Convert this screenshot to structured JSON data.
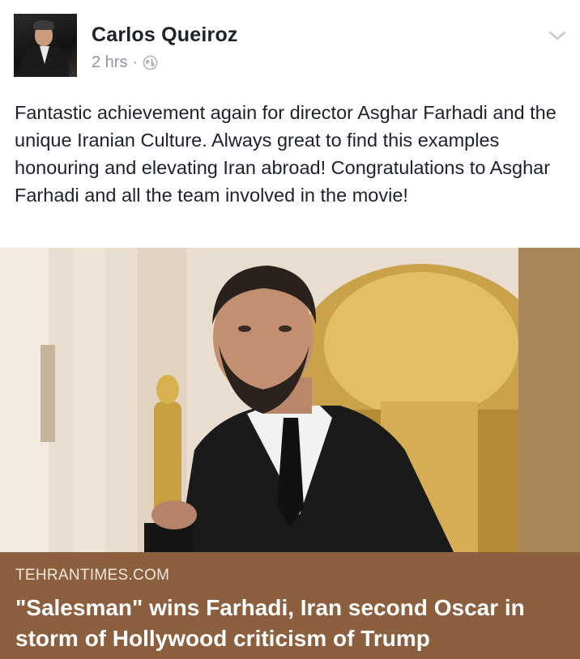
{
  "post": {
    "author": "Carlos Queiroz",
    "time": "2 hrs",
    "separator": "·",
    "privacy_icon": "globe-icon",
    "menu_icon": "chevron-down-icon",
    "text": "Fantastic achievement again for director Asghar Farhadi and the unique Iranian Culture. Always great to find this examples honouring and elevating Iran abroad! Congratulations to Asghar Farhadi and all the team involved in the movie!"
  },
  "link": {
    "domain": "TEHRANTIMES.COM",
    "title": "\"Salesman\" wins Farhadi, Iran second Oscar in storm of Hollywood criticism of Trump"
  },
  "colors": {
    "caption_bg": "#8c5f3f",
    "meta_gray": "#90949c",
    "text": "#1d2129"
  }
}
